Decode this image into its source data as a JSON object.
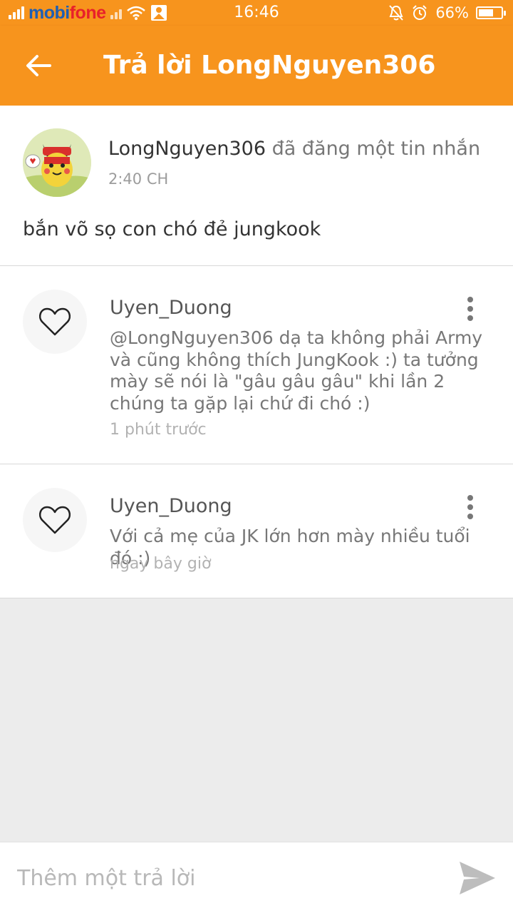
{
  "status_bar": {
    "carrier_part1": "mobi",
    "carrier_part2": "fone",
    "time": "16:46",
    "battery_text": "66%",
    "battery_level": 0.66,
    "icons": [
      "signal-icon",
      "wifi-icon",
      "notification-icon",
      "mute-icon",
      "alarm-icon",
      "battery-icon"
    ]
  },
  "app_bar": {
    "title": "Trả lời LongNguyen306",
    "back_icon": "arrow-back-icon",
    "color": "#f7941d"
  },
  "post": {
    "author": "LongNguyen306",
    "action": " đã đăng một tin nhắn",
    "time": "2:40 CH",
    "body": "bắn võ sọ con chó đẻ jungkook"
  },
  "replies": [
    {
      "user": "Uyen_Duong",
      "text": "@LongNguyen306  dạ ta không phải Army và cũng không thích JungKook :) ta tưởng mày sẽ nói là \"gâu gâu gâu\" khi lần 2 chúng ta gặp lại chứ đi chó :)",
      "time": "1 phút trước"
    },
    {
      "user": "Uyen_Duong",
      "text": "Với cả mẹ của JK lớn hơn mày nhiều tuổi đó :)",
      "time": "ngay bây giờ"
    }
  ],
  "composer": {
    "placeholder": "Thêm một trả lời",
    "send_icon": "send-icon"
  }
}
